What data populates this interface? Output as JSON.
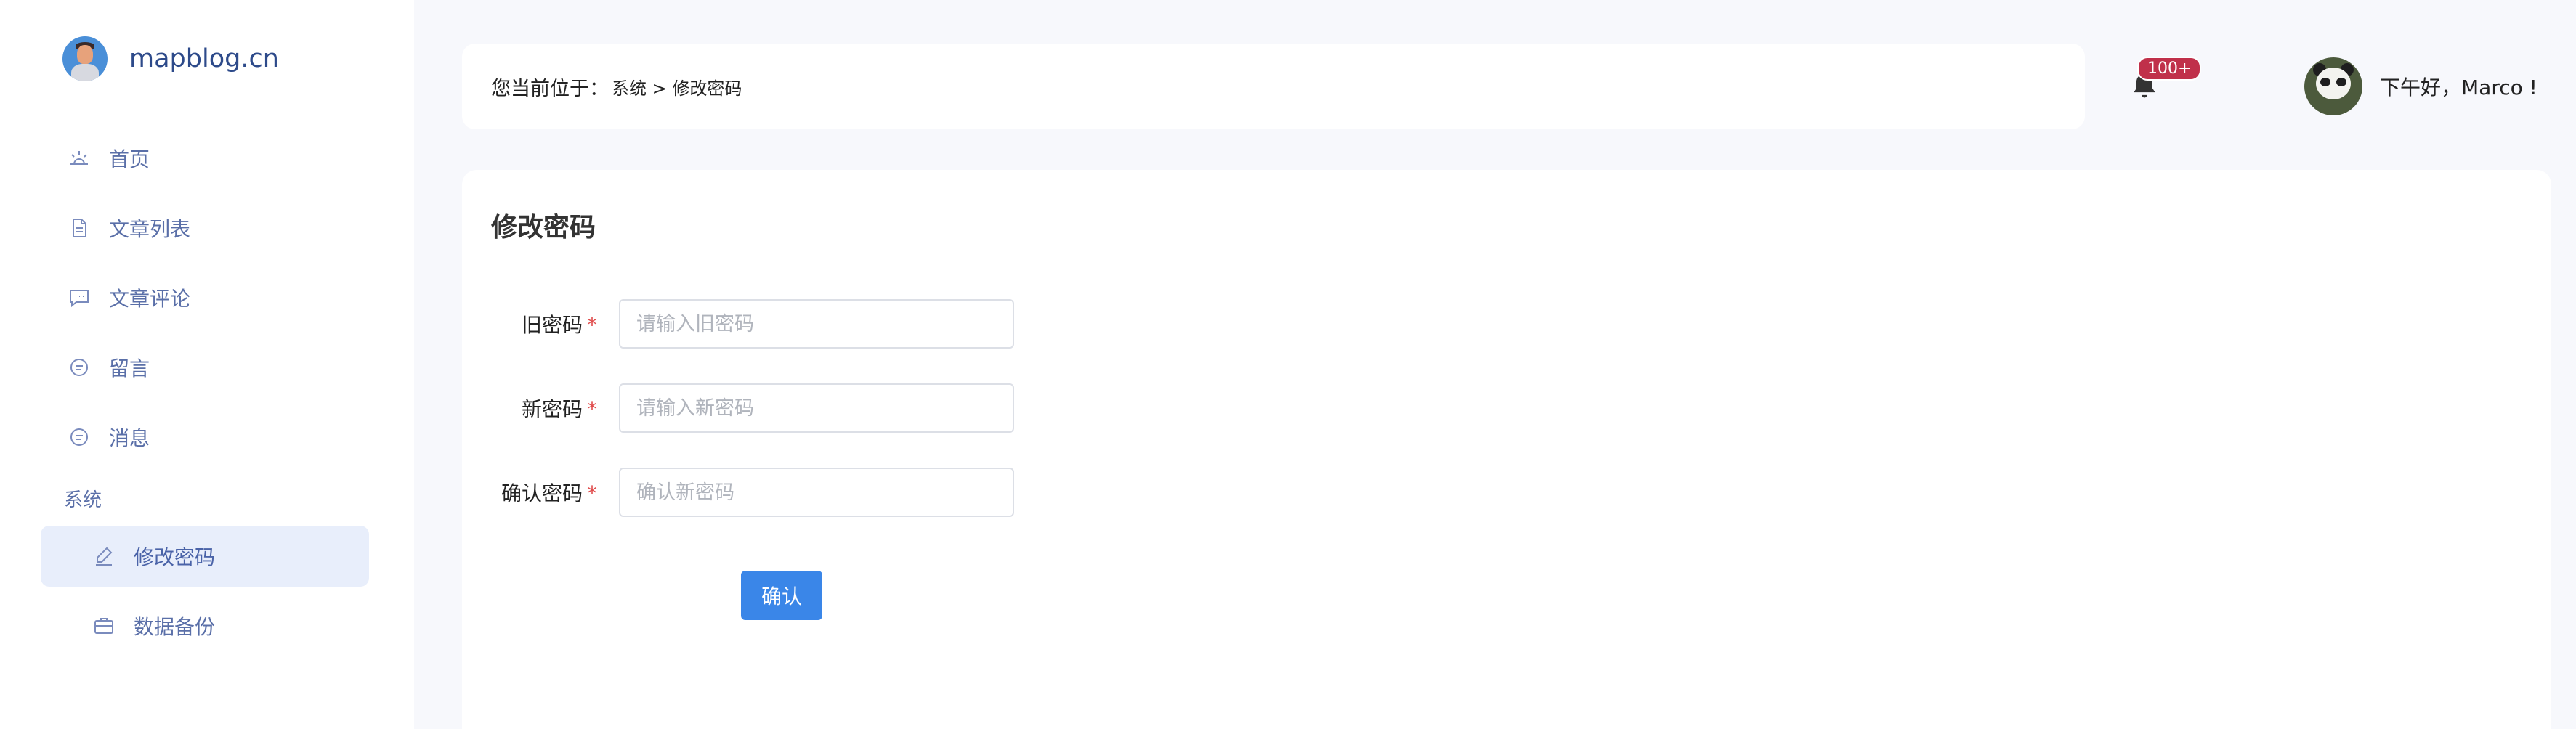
{
  "brand": {
    "name": "mapblog.cn"
  },
  "sidebar": {
    "items": [
      {
        "label": "首页",
        "icon": "sunrise-icon"
      },
      {
        "label": "文章列表",
        "icon": "document-icon"
      },
      {
        "label": "文章评论",
        "icon": "comment-icon"
      },
      {
        "label": "留言",
        "icon": "message-circle-icon"
      },
      {
        "label": "消息",
        "icon": "message-circle-icon"
      }
    ],
    "section": "系统",
    "sub_items": [
      {
        "label": "修改密码",
        "icon": "pen-icon",
        "active": true
      },
      {
        "label": "数据备份",
        "icon": "briefcase-icon",
        "active": false
      }
    ]
  },
  "header": {
    "breadcrumb_prefix": "您当前位于：",
    "breadcrumb_path": "系统 > 修改密码",
    "notification_badge": "100+",
    "greeting": "下午好，Marco !"
  },
  "main": {
    "title": "修改密码",
    "fields": [
      {
        "label": "旧密码",
        "required_mark": "*",
        "placeholder": "请输入旧密码",
        "value": ""
      },
      {
        "label": "新密码",
        "required_mark": "*",
        "placeholder": "请输入新密码",
        "value": ""
      },
      {
        "label": "确认密码",
        "required_mark": "*",
        "placeholder": "确认新密码",
        "value": ""
      }
    ],
    "confirm_label": "确认"
  },
  "colors": {
    "accent": "#3a86e8",
    "sidebar_text": "#5a6fa8",
    "active_bg": "#e8eefb",
    "badge": "#c0304a",
    "background": "#f7f8fc"
  }
}
